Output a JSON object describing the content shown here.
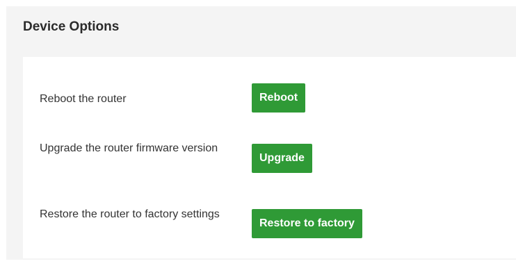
{
  "panel": {
    "title": "Device Options"
  },
  "options": [
    {
      "label": "Reboot the router",
      "button": "Reboot"
    },
    {
      "label": "Upgrade the router firmware version",
      "button": "Upgrade"
    },
    {
      "label": "Restore the router to factory settings",
      "button": "Restore to factory"
    }
  ],
  "colors": {
    "button_bg": "#2f9a36",
    "button_text": "#ffffff",
    "panel_bg": "#f4f4f4",
    "body_bg": "#ffffff"
  }
}
